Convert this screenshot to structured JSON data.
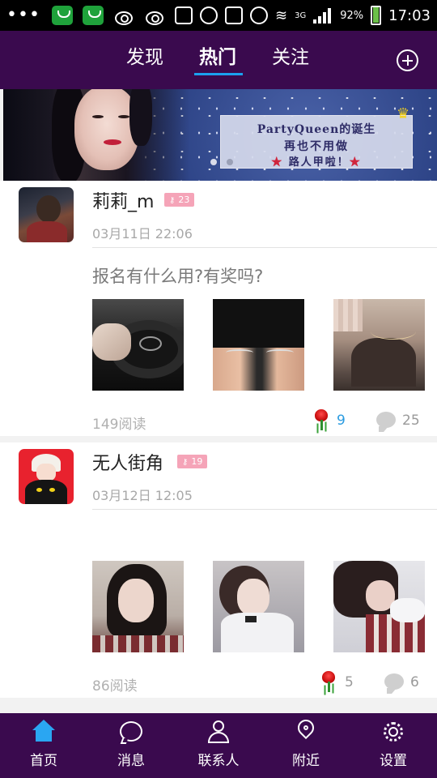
{
  "status_bar": {
    "battery_percent": "92%",
    "time": "17:03",
    "signal_text": "3G",
    "icons": [
      "overflow-dots-icon",
      "app-notification-icon",
      "app-notification-icon",
      "weibo-icon",
      "weibo-icon",
      "vibrate-icon",
      "alarm-icon",
      "nfc-icon",
      "data-saver-icon",
      "wifi-icon",
      "signal-icon",
      "battery-icon"
    ]
  },
  "top_nav": {
    "tabs": [
      {
        "label": "发现",
        "active": false
      },
      {
        "label": "热门",
        "active": true
      },
      {
        "label": "关注",
        "active": false
      }
    ],
    "add_icon": "plus-circle-icon",
    "accent_color": "#1ba1ef",
    "bg_color": "#3a0a4e"
  },
  "banner": {
    "line1": "PartyQueen的诞生",
    "line2": "再也不用做",
    "line3": "路人甲啦！",
    "star_glyph": "★",
    "crown_glyph": "♛",
    "active_dot": 1,
    "dot_count": 2
  },
  "posts": [
    {
      "username": "莉莉_m",
      "level": "23",
      "time": "03月11日 22:06",
      "text": "报名有什么用?有奖吗?",
      "reads": "149阅读",
      "flowers": "9",
      "comments": "25",
      "images": [
        "car-steering-wheel-photo",
        "stockings-photo",
        "blurred-selfie-photo"
      ]
    },
    {
      "username": "无人街角",
      "level": "19",
      "time": "03月12日 12:05",
      "text": "",
      "reads": "86阅读",
      "flowers": "5",
      "comments": "6",
      "images": [
        "girl-selfie-photo",
        "girl-profile-photo",
        "girl-lying-photo"
      ]
    }
  ],
  "bottom_nav": {
    "items": [
      {
        "label": "首页",
        "icon": "home-icon",
        "active": true
      },
      {
        "label": "消息",
        "icon": "message-icon",
        "active": false
      },
      {
        "label": "联系人",
        "icon": "contacts-icon",
        "active": false
      },
      {
        "label": "附近",
        "icon": "location-pin-icon",
        "active": false
      },
      {
        "label": "设置",
        "icon": "gear-icon",
        "active": false
      }
    ]
  }
}
